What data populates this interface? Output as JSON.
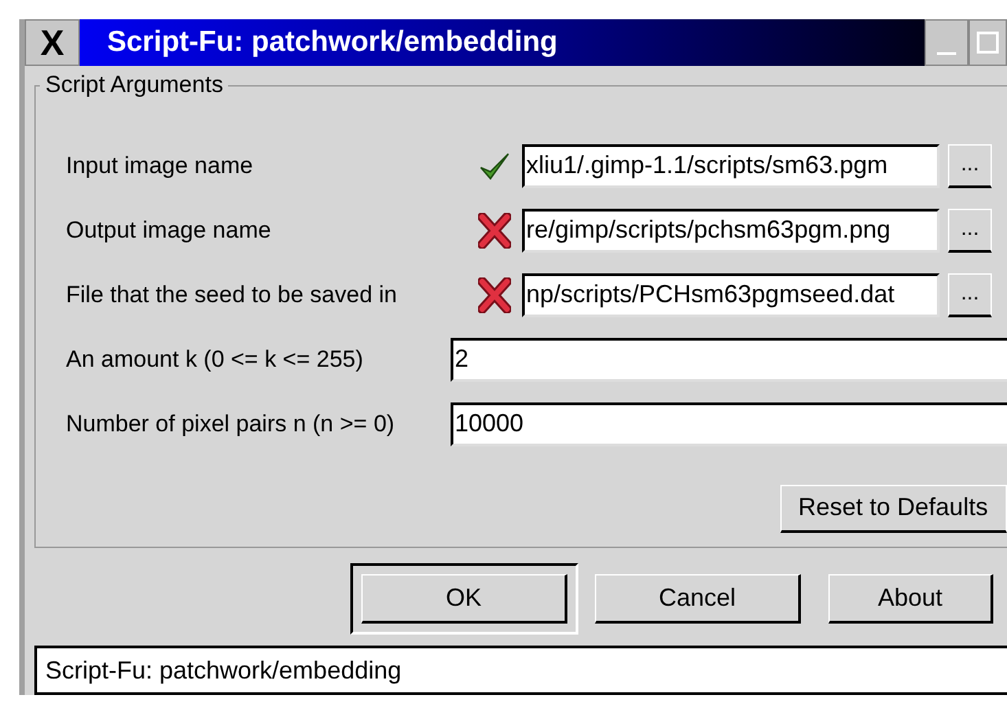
{
  "window": {
    "title": "Script-Fu: patchwork/embedding",
    "icon_glyph": "X"
  },
  "group": {
    "title": "Script Arguments",
    "rows": [
      {
        "kind": "file",
        "label": "Input image name",
        "valid": true,
        "value": "xliu1/.gimp-1.1/scripts/sm63.pgm",
        "browse": "..."
      },
      {
        "kind": "file",
        "label": "Output image name",
        "valid": false,
        "value": "re/gimp/scripts/pchsm63pgm.png",
        "browse": "..."
      },
      {
        "kind": "file",
        "label": "File that the seed to be saved in",
        "valid": false,
        "value": "np/scripts/PCHsm63pgmseed.dat",
        "browse": "..."
      },
      {
        "kind": "text",
        "label": "An amount k (0 <= k <= 255)",
        "value": "2"
      },
      {
        "kind": "text",
        "label": "Number of pixel pairs n (n >= 0)",
        "value": "10000"
      }
    ],
    "reset_button": "Reset to Defaults"
  },
  "buttons": [
    {
      "label": "OK",
      "default": true
    },
    {
      "label": "Cancel",
      "default": false
    },
    {
      "label": "About",
      "default": false
    }
  ],
  "status_bar": "Script-Fu: patchwork/embedding"
}
